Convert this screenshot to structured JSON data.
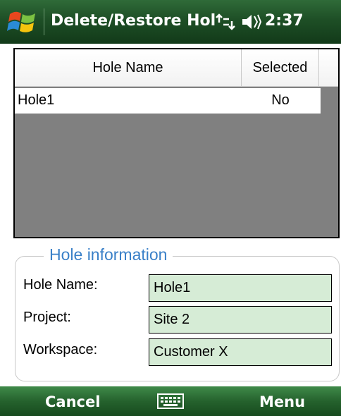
{
  "titlebar": {
    "title": "Delete/Restore Hol",
    "clock": "2:37",
    "icons": [
      "windows-start-icon",
      "connectivity-icon",
      "volume-icon"
    ]
  },
  "grid": {
    "columns": [
      "Hole Name",
      "Selected"
    ],
    "rows": [
      {
        "name": "Hole1",
        "selected": "No"
      }
    ]
  },
  "hole_info": {
    "legend": "Hole information",
    "fields": [
      {
        "label": "Hole Name:",
        "value": "Hole1"
      },
      {
        "label": "Project:",
        "value": "Site 2"
      },
      {
        "label": "Workspace:",
        "value": "Customer X"
      }
    ]
  },
  "softkeys": {
    "left": "Cancel",
    "right": "Menu",
    "center_icon": "keyboard-icon"
  },
  "colors": {
    "titlebar": "#1e4f26",
    "softbar": "#25622d",
    "legend": "#3a80c8",
    "field_bg": "#d6ecd6",
    "grid_bg": "#808080"
  }
}
